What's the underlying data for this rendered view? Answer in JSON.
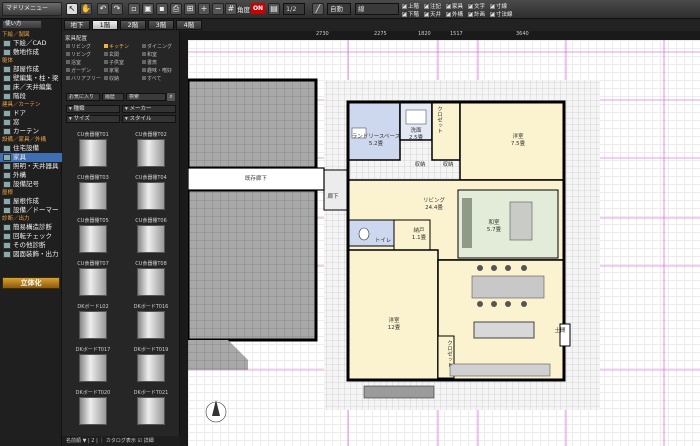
{
  "toolbar": {
    "menu_label": "マドリメニュー",
    "kakudo": "角度",
    "on_badge": "ON",
    "scale": "1/2",
    "auto": "自動",
    "line": "線",
    "checks": [
      "上階",
      "注記",
      "家具",
      "文字",
      "寸線",
      "下階",
      "天井",
      "外構",
      "計画",
      "寸法線"
    ]
  },
  "left_panel": {
    "tab_label": "使い方",
    "sections": [
      {
        "title": "下絵／製図",
        "items": [
          "下絵／CAD",
          "敷地作成"
        ]
      },
      {
        "title": "躯体",
        "items": [
          "部屋作成",
          "壁編集・柱・梁",
          "床／天井編集",
          "階段"
        ]
      },
      {
        "title": "建具／カーテン",
        "items": [
          "ドア",
          "窓",
          "カーテン"
        ]
      },
      {
        "title": "設備／家具／外構",
        "items": [
          "住宅設備",
          "家具",
          "照明・天井器具",
          "外構",
          "設備記号"
        ]
      },
      {
        "title": "屋根",
        "items": [
          "屋根作成",
          "設備／ドーマー"
        ]
      },
      {
        "title": "診断／出力",
        "items": [
          "簡易構造診断",
          "回転チェック",
          "その他診断",
          "図面装飾・出力"
        ]
      }
    ],
    "selected_item": "家具",
    "rittaika": "立体化"
  },
  "floor_tabs": [
    "地下",
    "1階",
    "2階",
    "3階",
    "4階"
  ],
  "catalog": {
    "title": "家具配置",
    "categories": [
      "リビング",
      "キッチン",
      "ダイニング",
      "リビング",
      "玄関",
      "和室",
      "浴室",
      "子供室",
      "書斎",
      "ガーデン",
      "家電",
      "趣味・嗜好",
      "バリアフリー",
      "収納",
      "すべて"
    ],
    "selected_category": "キッチン",
    "fav": "お気に入り",
    "history": "履歴",
    "search": "検索",
    "filters": [
      "種類",
      "メーカー",
      "サイズ",
      "スタイル"
    ],
    "items": [
      "CU食器棚T01",
      "CU食器棚T02",
      "CU食器棚T03",
      "CU食器棚T04",
      "CU食器棚T05",
      "CU食器棚T06",
      "CU食器棚T07",
      "CU食器棚T08",
      "DKボードL02",
      "DKボードT016",
      "DKボードT017",
      "DKボードT019",
      "DKボードT020",
      "DKボードT021"
    ],
    "footer": "名前順 ▼  | 2 | ｜ カタログ表示 ☑ 詳細"
  },
  "ruler": [
    "2730",
    "2275",
    "1820",
    "1517",
    "3640"
  ],
  "rooms": {
    "laundry": "ランドリースペース\n5.2畳",
    "wash": "洗面\n2.5畳",
    "closet1": "クロゼット",
    "yoshitsu1": "洋室\n7.5畳",
    "storage1": "収納",
    "storage2": "収納",
    "corridor": "既存廊下",
    "living": "リビング\n24.4畳",
    "washitsu": "和室\n5.7畳",
    "toilet": "トイレ",
    "nando": "納戸\n1.1畳",
    "yoshitsu2": "洋室\n12畳",
    "closet2": "クロゼット",
    "doma": "土間",
    "rouka": "廊下"
  },
  "colors": {
    "accent": "#3f6fb3",
    "orange": "#f0a040",
    "blue_room": "#cdd8ef",
    "yellow_room": "#fbf3cf",
    "green_room": "#e3ecd8"
  }
}
